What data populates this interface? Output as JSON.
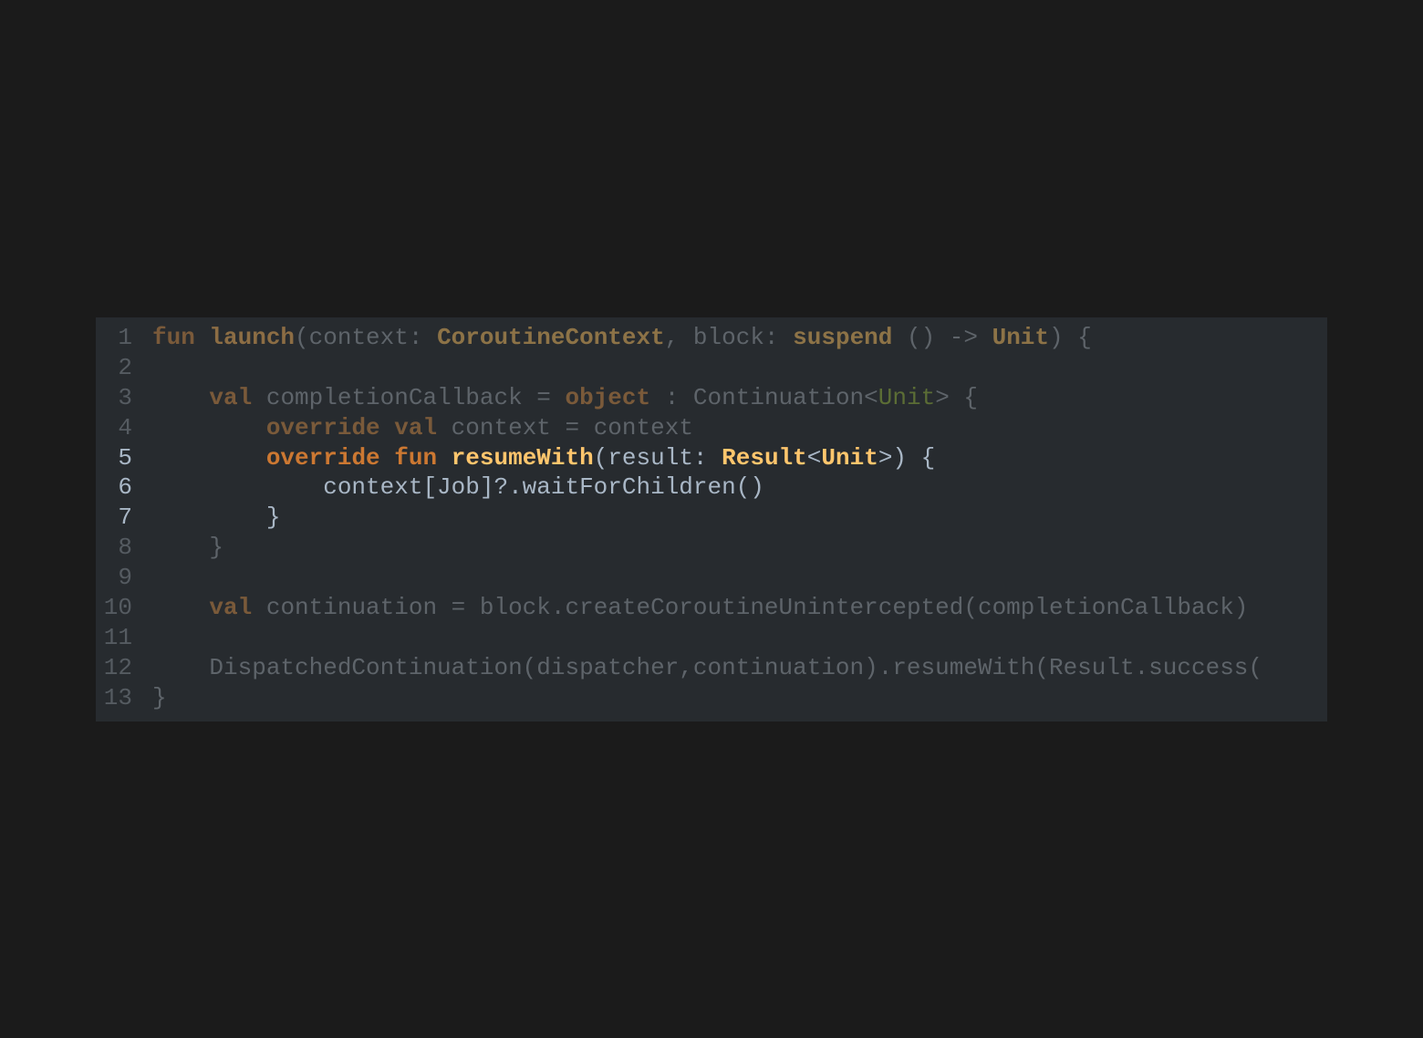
{
  "editor": {
    "lines": [
      {
        "number": "1",
        "focus": false,
        "tokens": [
          {
            "t": "fun",
            "c": "kw"
          },
          {
            "t": " ",
            "c": "tx"
          },
          {
            "t": "launch",
            "c": "fn"
          },
          {
            "t": "(context: ",
            "c": "tx"
          },
          {
            "t": "CoroutineContext",
            "c": "ty"
          },
          {
            "t": ", block: ",
            "c": "tx"
          },
          {
            "t": "suspend",
            "c": "ty"
          },
          {
            "t": " () -> ",
            "c": "tx"
          },
          {
            "t": "Unit",
            "c": "ty"
          },
          {
            "t": ") {",
            "c": "tx"
          }
        ]
      },
      {
        "number": "2",
        "focus": false,
        "tokens": []
      },
      {
        "number": "3",
        "focus": false,
        "tokens": [
          {
            "t": "    ",
            "c": "tx"
          },
          {
            "t": "val",
            "c": "kw"
          },
          {
            "t": " completionCallback = ",
            "c": "tx"
          },
          {
            "t": "object",
            "c": "kw"
          },
          {
            "t": " : Continuation<",
            "c": "tx"
          },
          {
            "t": "Unit",
            "c": "gen"
          },
          {
            "t": "> {",
            "c": "tx"
          }
        ]
      },
      {
        "number": "4",
        "focus": false,
        "tokens": [
          {
            "t": "        ",
            "c": "tx"
          },
          {
            "t": "override",
            "c": "kw"
          },
          {
            "t": " ",
            "c": "tx"
          },
          {
            "t": "val",
            "c": "kw"
          },
          {
            "t": " context = context",
            "c": "tx"
          }
        ]
      },
      {
        "number": "5",
        "focus": true,
        "tokens": [
          {
            "t": "        ",
            "c": "tx"
          },
          {
            "t": "override",
            "c": "kw"
          },
          {
            "t": " ",
            "c": "tx"
          },
          {
            "t": "fun",
            "c": "kw"
          },
          {
            "t": " ",
            "c": "tx"
          },
          {
            "t": "resumeWith",
            "c": "fn"
          },
          {
            "t": "(result: ",
            "c": "tx"
          },
          {
            "t": "Result",
            "c": "ty"
          },
          {
            "t": "<",
            "c": "tx"
          },
          {
            "t": "Unit",
            "c": "ty"
          },
          {
            "t": ">) {",
            "c": "tx"
          }
        ]
      },
      {
        "number": "6",
        "focus": true,
        "tokens": [
          {
            "t": "            context[Job]?.waitForChildren()",
            "c": "tx"
          }
        ]
      },
      {
        "number": "7",
        "focus": true,
        "tokens": [
          {
            "t": "        }",
            "c": "tx"
          }
        ]
      },
      {
        "number": "8",
        "focus": false,
        "tokens": [
          {
            "t": "    }",
            "c": "tx"
          }
        ]
      },
      {
        "number": "9",
        "focus": false,
        "tokens": []
      },
      {
        "number": "10",
        "focus": false,
        "tokens": [
          {
            "t": "    ",
            "c": "tx"
          },
          {
            "t": "val",
            "c": "kw"
          },
          {
            "t": " continuation = block.createCoroutineUnintercepted(completionCallback)",
            "c": "tx"
          }
        ]
      },
      {
        "number": "11",
        "focus": false,
        "tokens": []
      },
      {
        "number": "12",
        "focus": false,
        "tokens": [
          {
            "t": "    DispatchedContinuation(dispatcher,continuation).resumeWith(Result.success(",
            "c": "tx"
          }
        ]
      },
      {
        "number": "13",
        "focus": false,
        "tokens": [
          {
            "t": "}",
            "c": "tx"
          }
        ]
      }
    ]
  }
}
